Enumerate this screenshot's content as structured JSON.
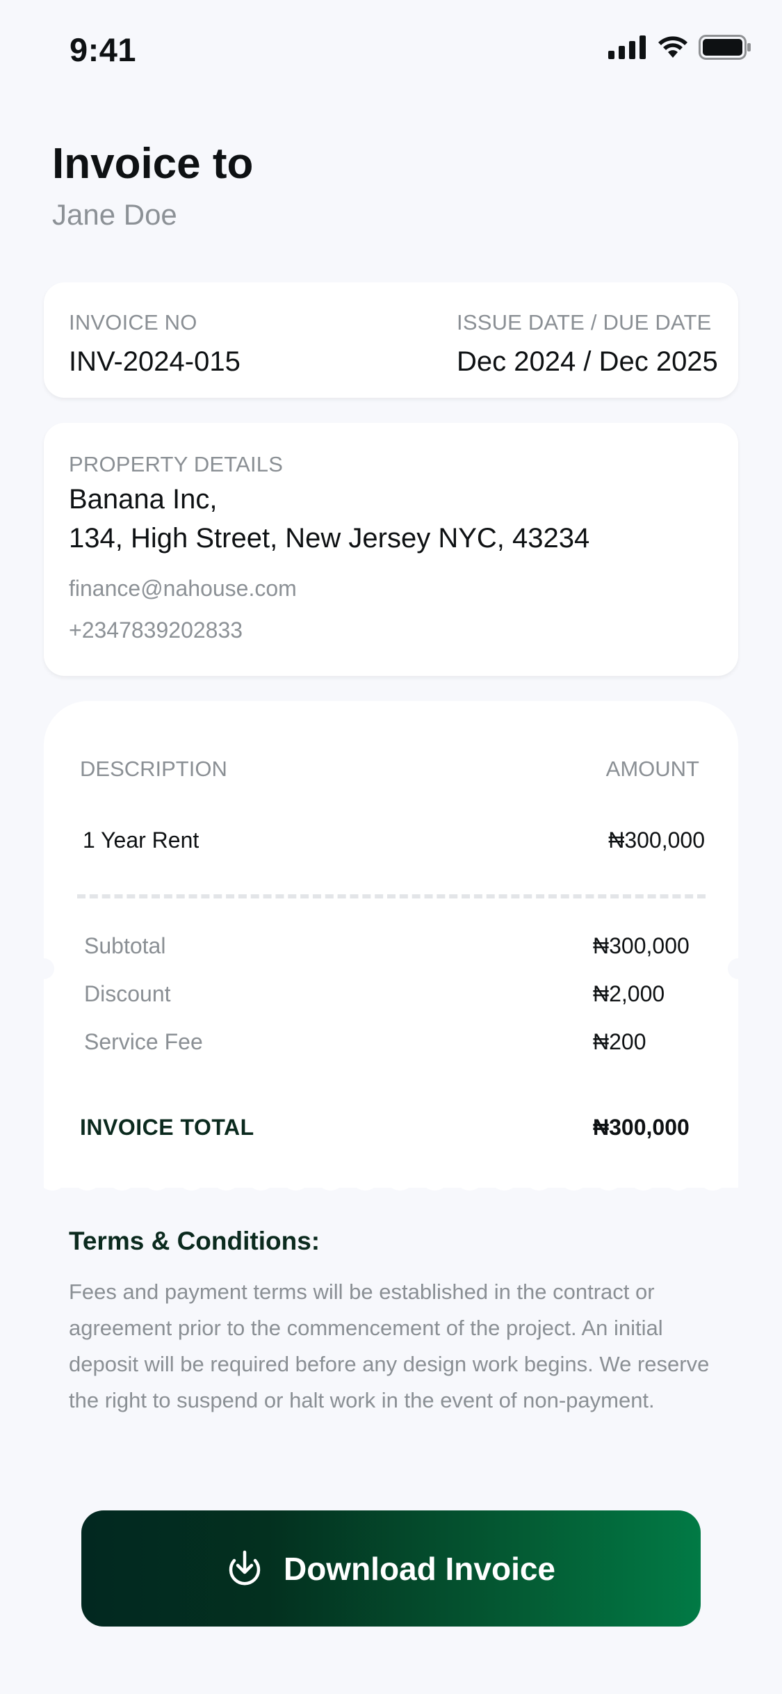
{
  "status_bar": {
    "time": "9:41",
    "icons": [
      "cellular-signal-icon",
      "wifi-icon",
      "battery-icon"
    ]
  },
  "header": {
    "title": "Invoice to",
    "recipient": "Jane Doe"
  },
  "invoice_meta": {
    "invoice_no_label": "INVOICE NO",
    "invoice_no": "INV-2024-015",
    "dates_label": "ISSUE DATE / DUE DATE",
    "dates": "Dec 2024 / Dec 2025"
  },
  "property": {
    "label": "PROPERTY DETAILS",
    "name": "Banana Inc,",
    "address": "134, High Street, New Jersey NYC, 43234",
    "email": "finance@nahouse.com",
    "phone": "+2347839202833"
  },
  "receipt": {
    "col_description": "DESCRIPTION",
    "col_amount": "AMOUNT",
    "items": [
      {
        "description": "1 Year Rent",
        "amount": "₦300,000"
      }
    ],
    "summary": [
      {
        "label": "Subtotal",
        "value": "₦300,000"
      },
      {
        "label": "Discount",
        "value": "₦2,000"
      },
      {
        "label": "Service Fee",
        "value": "₦200"
      }
    ],
    "total_label": "INVOICE TOTAL",
    "total_value": "₦300,000"
  },
  "terms": {
    "title": "Terms & Conditions:",
    "body": "Fees and payment terms will be established in the contract or agreement prior to the commencement of the project. An initial deposit will be required before any design work begins. We reserve the right to suspend or halt work in the event of non-payment."
  },
  "actions": {
    "download_label": "Download Invoice",
    "download_icon": "download-icon"
  },
  "colors": {
    "background": "#F7F8FC",
    "card": "#FFFFFF",
    "text_primary": "#0E1113",
    "text_muted": "#8A8F94",
    "accent_dark": "#0B2A1E",
    "button_gradient_start": "#022820",
    "button_gradient_end": "#017A45"
  }
}
